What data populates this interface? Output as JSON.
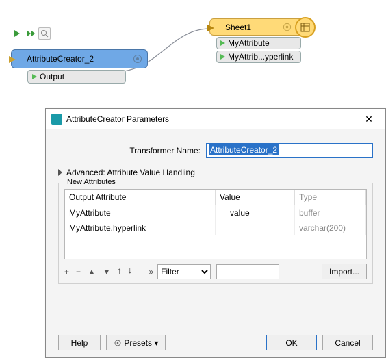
{
  "canvas": {
    "node1": {
      "title": "AttributeCreator_2",
      "output": "Output"
    },
    "node2": {
      "title": "Sheet1",
      "ports": [
        "MyAttribute",
        "MyAttrib...yperlink"
      ]
    }
  },
  "dialog": {
    "title": "AttributeCreator Parameters",
    "transformer_label": "Transformer Name:",
    "transformer_value": "AttributeCreator_2",
    "advanced": "Advanced: Attribute Value Handling",
    "group": "New Attributes",
    "cols": {
      "c1": "Output Attribute",
      "c2": "Value",
      "c3": "Type"
    },
    "rows": [
      {
        "attr": "MyAttribute",
        "val": "value",
        "type": "buffer"
      },
      {
        "attr": "MyAttribute.hyperlink",
        "val": "",
        "type": "varchar(200)"
      }
    ],
    "filter": "Filter",
    "import": "Import...",
    "help": "Help",
    "presets": "Presets",
    "ok": "OK",
    "cancel": "Cancel"
  }
}
